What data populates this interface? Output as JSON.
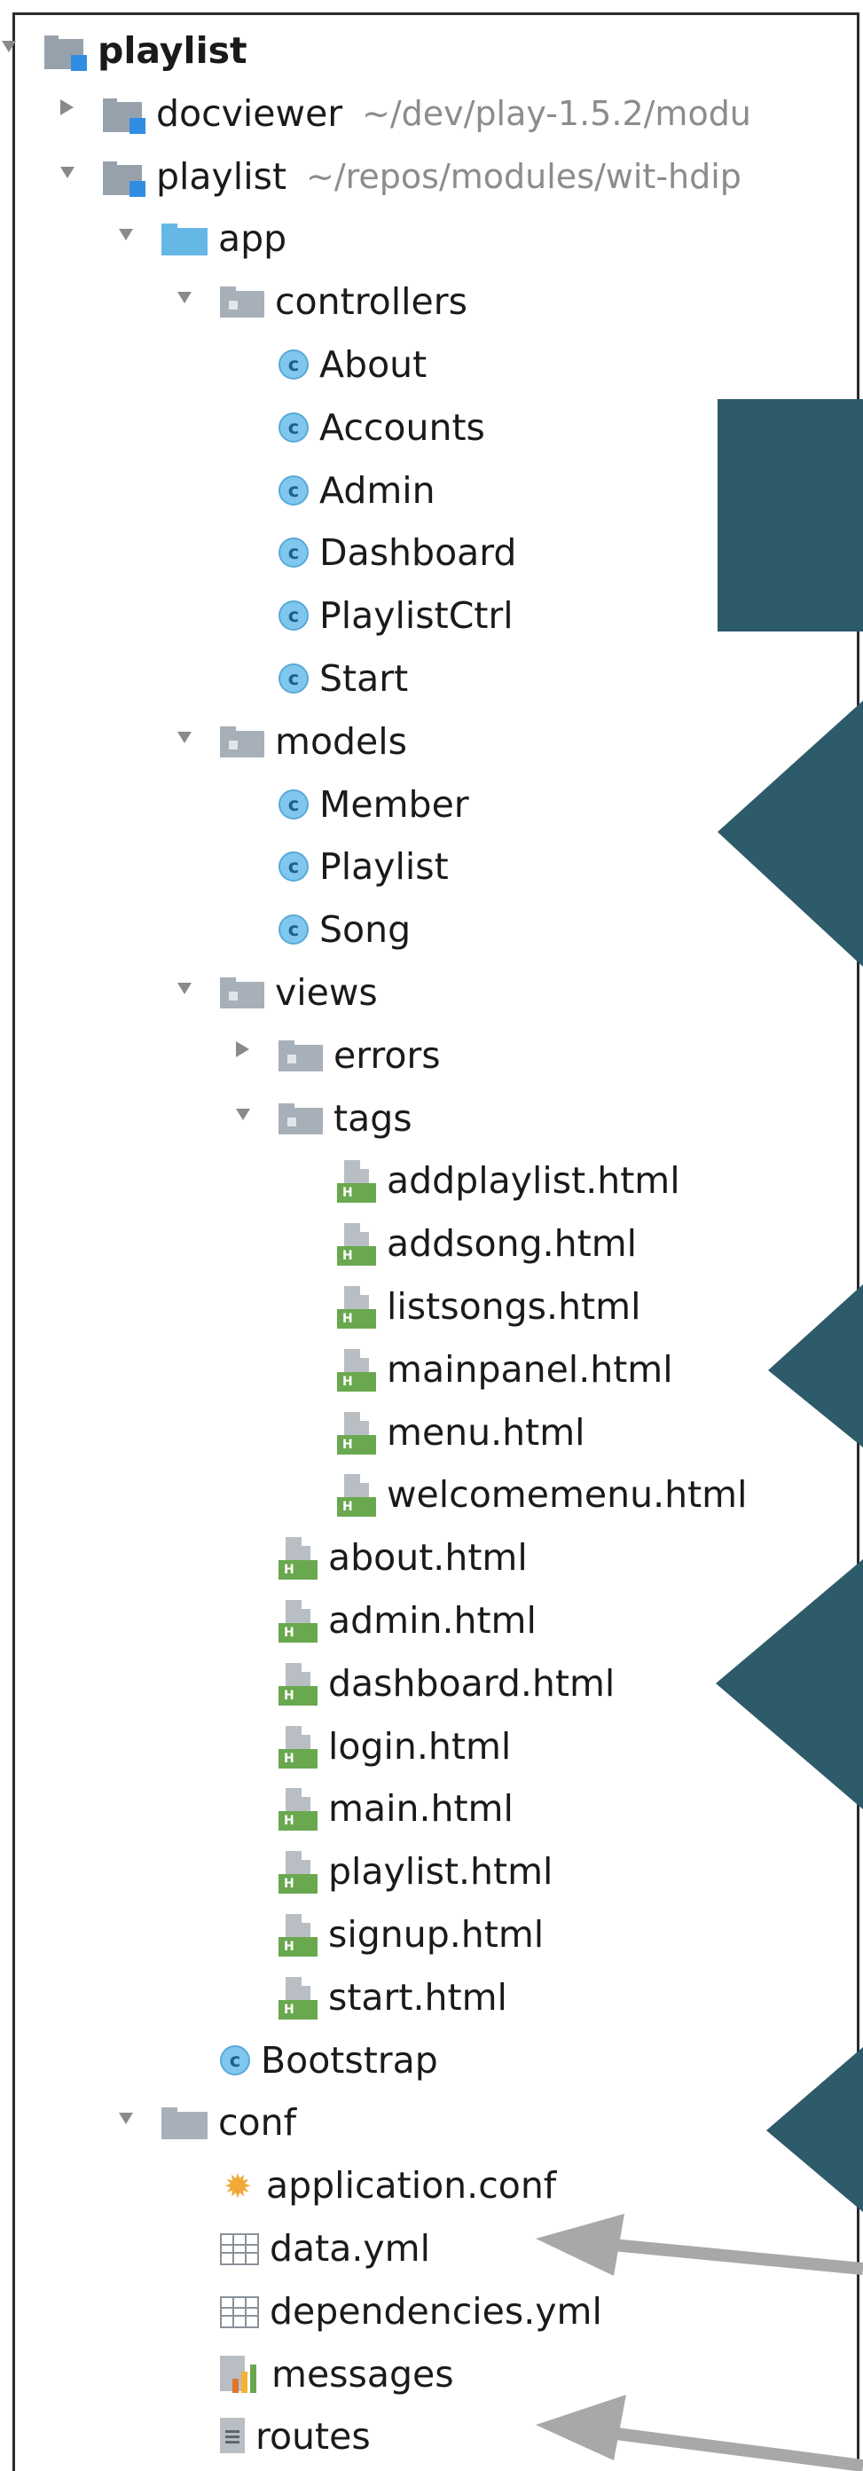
{
  "tree": [
    {
      "label": "playlist",
      "icon": "module-icon",
      "arrow": "open",
      "depth": 0,
      "bold": true,
      "hint": ""
    },
    {
      "label": "docviewer",
      "icon": "module-icon",
      "arrow": "closed",
      "depth": 1,
      "bold": false,
      "hint": "~/dev/play-1.5.2/modu"
    },
    {
      "label": "playlist",
      "icon": "module-icon",
      "arrow": "open",
      "depth": 1,
      "bold": false,
      "hint": "~/repos/modules/wit-hdip"
    },
    {
      "label": "app",
      "icon": "source-folder-icon",
      "arrow": "open",
      "depth": 2,
      "bold": false,
      "hint": ""
    },
    {
      "label": "controllers",
      "icon": "package-icon",
      "arrow": "open",
      "depth": 3,
      "bold": false,
      "hint": ""
    },
    {
      "label": "About",
      "icon": "class-icon",
      "arrow": "",
      "depth": 4,
      "bold": false,
      "hint": ""
    },
    {
      "label": "Accounts",
      "icon": "class-icon",
      "arrow": "",
      "depth": 4,
      "bold": false,
      "hint": ""
    },
    {
      "label": "Admin",
      "icon": "class-icon",
      "arrow": "",
      "depth": 4,
      "bold": false,
      "hint": ""
    },
    {
      "label": "Dashboard",
      "icon": "class-icon",
      "arrow": "",
      "depth": 4,
      "bold": false,
      "hint": ""
    },
    {
      "label": "PlaylistCtrl",
      "icon": "class-icon",
      "arrow": "",
      "depth": 4,
      "bold": false,
      "hint": ""
    },
    {
      "label": "Start",
      "icon": "class-icon",
      "arrow": "",
      "depth": 4,
      "bold": false,
      "hint": ""
    },
    {
      "label": "models",
      "icon": "package-icon",
      "arrow": "open",
      "depth": 3,
      "bold": false,
      "hint": ""
    },
    {
      "label": "Member",
      "icon": "class-icon",
      "arrow": "",
      "depth": 4,
      "bold": false,
      "hint": ""
    },
    {
      "label": "Playlist",
      "icon": "class-icon",
      "arrow": "",
      "depth": 4,
      "bold": false,
      "hint": ""
    },
    {
      "label": "Song",
      "icon": "class-icon",
      "arrow": "",
      "depth": 4,
      "bold": false,
      "hint": ""
    },
    {
      "label": "views",
      "icon": "package-icon",
      "arrow": "open",
      "depth": 3,
      "bold": false,
      "hint": ""
    },
    {
      "label": "errors",
      "icon": "package-icon",
      "arrow": "closed",
      "depth": 4,
      "bold": false,
      "hint": ""
    },
    {
      "label": "tags",
      "icon": "package-icon",
      "arrow": "open",
      "depth": 4,
      "bold": false,
      "hint": ""
    },
    {
      "label": "addplaylist.html",
      "icon": "html-file-icon",
      "arrow": "",
      "depth": 5,
      "bold": false,
      "hint": ""
    },
    {
      "label": "addsong.html",
      "icon": "html-file-icon",
      "arrow": "",
      "depth": 5,
      "bold": false,
      "hint": ""
    },
    {
      "label": "listsongs.html",
      "icon": "html-file-icon",
      "arrow": "",
      "depth": 5,
      "bold": false,
      "hint": ""
    },
    {
      "label": "mainpanel.html",
      "icon": "html-file-icon",
      "arrow": "",
      "depth": 5,
      "bold": false,
      "hint": ""
    },
    {
      "label": "menu.html",
      "icon": "html-file-icon",
      "arrow": "",
      "depth": 5,
      "bold": false,
      "hint": ""
    },
    {
      "label": "welcomemenu.html",
      "icon": "html-file-icon",
      "arrow": "",
      "depth": 5,
      "bold": false,
      "hint": ""
    },
    {
      "label": "about.html",
      "icon": "html-file-icon",
      "arrow": "",
      "depth": 4,
      "bold": false,
      "hint": ""
    },
    {
      "label": "admin.html",
      "icon": "html-file-icon",
      "arrow": "",
      "depth": 4,
      "bold": false,
      "hint": ""
    },
    {
      "label": "dashboard.html",
      "icon": "html-file-icon",
      "arrow": "",
      "depth": 4,
      "bold": false,
      "hint": ""
    },
    {
      "label": "login.html",
      "icon": "html-file-icon",
      "arrow": "",
      "depth": 4,
      "bold": false,
      "hint": ""
    },
    {
      "label": "main.html",
      "icon": "html-file-icon",
      "arrow": "",
      "depth": 4,
      "bold": false,
      "hint": ""
    },
    {
      "label": "playlist.html",
      "icon": "html-file-icon",
      "arrow": "",
      "depth": 4,
      "bold": false,
      "hint": ""
    },
    {
      "label": "signup.html",
      "icon": "html-file-icon",
      "arrow": "",
      "depth": 4,
      "bold": false,
      "hint": ""
    },
    {
      "label": "start.html",
      "icon": "html-file-icon",
      "arrow": "",
      "depth": 4,
      "bold": false,
      "hint": ""
    },
    {
      "label": "Bootstrap",
      "icon": "class-icon",
      "arrow": "",
      "depth": 3,
      "bold": false,
      "hint": ""
    },
    {
      "label": "conf",
      "icon": "folder-icon",
      "arrow": "open",
      "depth": 2,
      "bold": false,
      "hint": ""
    },
    {
      "label": "application.conf",
      "icon": "config-icon",
      "arrow": "",
      "depth": 3,
      "bold": false,
      "hint": ""
    },
    {
      "label": "data.yml",
      "icon": "yml-file-icon",
      "arrow": "",
      "depth": 3,
      "bold": false,
      "hint": ""
    },
    {
      "label": "dependencies.yml",
      "icon": "yml-file-icon",
      "arrow": "",
      "depth": 3,
      "bold": false,
      "hint": ""
    },
    {
      "label": "messages",
      "icon": "messages-file-icon",
      "arrow": "",
      "depth": 3,
      "bold": false,
      "hint": ""
    },
    {
      "label": "routes",
      "icon": "routes-file-icon",
      "arrow": "",
      "depth": 3,
      "bold": false,
      "hint": ""
    }
  ],
  "colors": {
    "callout_triangle": "#2e5b6a",
    "callout_arrow": "#a8a8a8",
    "class_icon": "#7fc7ef",
    "source_folder": "#65b7e6",
    "module_badge": "#2f8ee3",
    "html_badge": "#6aa84f"
  }
}
